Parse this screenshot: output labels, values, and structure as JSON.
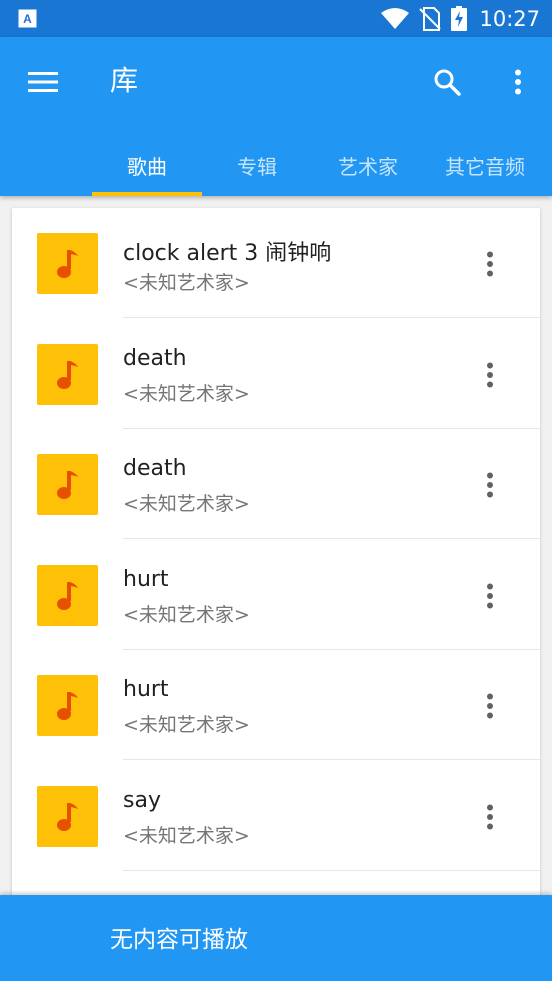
{
  "status_bar": {
    "time": "10:27",
    "app_icon": "font-a-icon"
  },
  "app_bar": {
    "title": "库",
    "menu_icon": "hamburger-menu-icon",
    "search_icon": "search-icon",
    "more_icon": "more-vertical-icon"
  },
  "tabs": [
    {
      "label": "歌曲",
      "active": true
    },
    {
      "label": "专辑",
      "active": false
    },
    {
      "label": "艺术家",
      "active": false
    },
    {
      "label": "其它音频",
      "active": false
    }
  ],
  "songs": [
    {
      "title": "clock alert 3 闹钟响",
      "artist": "<未知艺术家>"
    },
    {
      "title": "death",
      "artist": "<未知艺术家>"
    },
    {
      "title": "death",
      "artist": "<未知艺术家>"
    },
    {
      "title": "hurt",
      "artist": "<未知艺术家>"
    },
    {
      "title": "hurt",
      "artist": "<未知艺术家>"
    },
    {
      "title": "say",
      "artist": "<未知艺术家>"
    }
  ],
  "bottom_bar": {
    "text": "无内容可播放"
  },
  "colors": {
    "primary": "#2196f3",
    "primary_dark": "#1976d2",
    "accent": "#ffc107",
    "note_icon": "#e65100"
  }
}
